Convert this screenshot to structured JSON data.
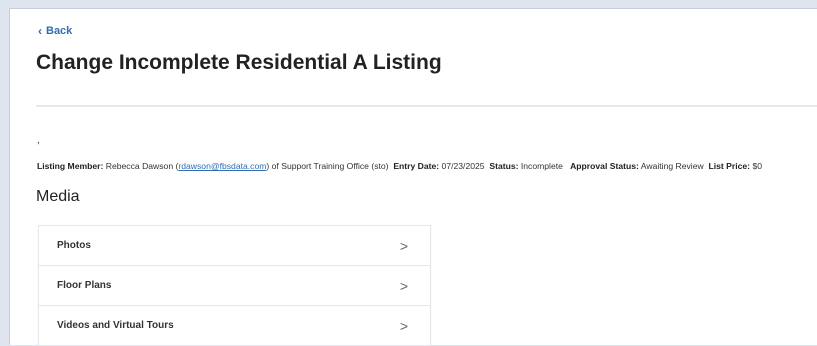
{
  "nav": {
    "back_label": "Back"
  },
  "page": {
    "title": "Change Incomplete Residential A Listing",
    "stray_mark": ","
  },
  "listing": {
    "member_label": "Listing Member:",
    "member_name": "Rebecca Dawson",
    "member_email": "rdawson@fbsdata.com",
    "member_office": "of Support Training Office (sto)",
    "entry_date_label": "Entry Date:",
    "entry_date": "07/23/2025",
    "status_label": "Status:",
    "status": "Incomplete",
    "approval_status_label_1": "Approval",
    "approval_status_label_2": "Status:",
    "approval_status": "Awaiting Review",
    "list_price_label": "List Price:",
    "list_price": "$0"
  },
  "media": {
    "heading": "Media",
    "items": [
      {
        "label": "Photos",
        "arrow": ">"
      },
      {
        "label": "Floor Plans",
        "arrow": ">"
      },
      {
        "label": "Videos and Virtual Tours",
        "arrow": ">"
      }
    ]
  },
  "colors": {
    "link": "#2f6db5",
    "text": "#222222",
    "divider": "#e6e8eb"
  },
  "icons": {
    "back": "chevron-left-icon",
    "item_arrow": "chevron-right-icon"
  }
}
